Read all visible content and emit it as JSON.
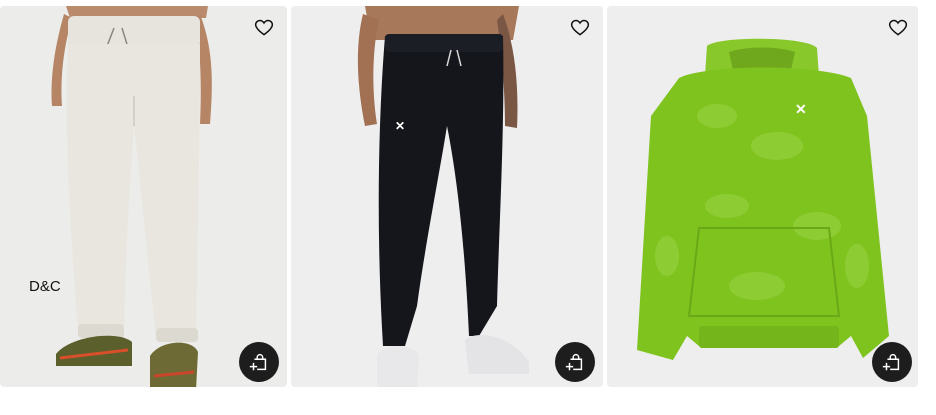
{
  "products": [
    {
      "overlay_text": "D&C",
      "favorite_icon": "heart-outline-icon",
      "quick_add_icon": "bag-plus-icon"
    },
    {
      "favorite_icon": "heart-outline-icon",
      "quick_add_icon": "bag-plus-icon"
    },
    {
      "favorite_icon": "heart-outline-icon",
      "quick_add_icon": "bag-plus-icon"
    }
  ],
  "colors": {
    "card_bg": "#f0f0f0",
    "button_bg": "#1d1d1d",
    "hoodie_green": "#7fc31f"
  }
}
